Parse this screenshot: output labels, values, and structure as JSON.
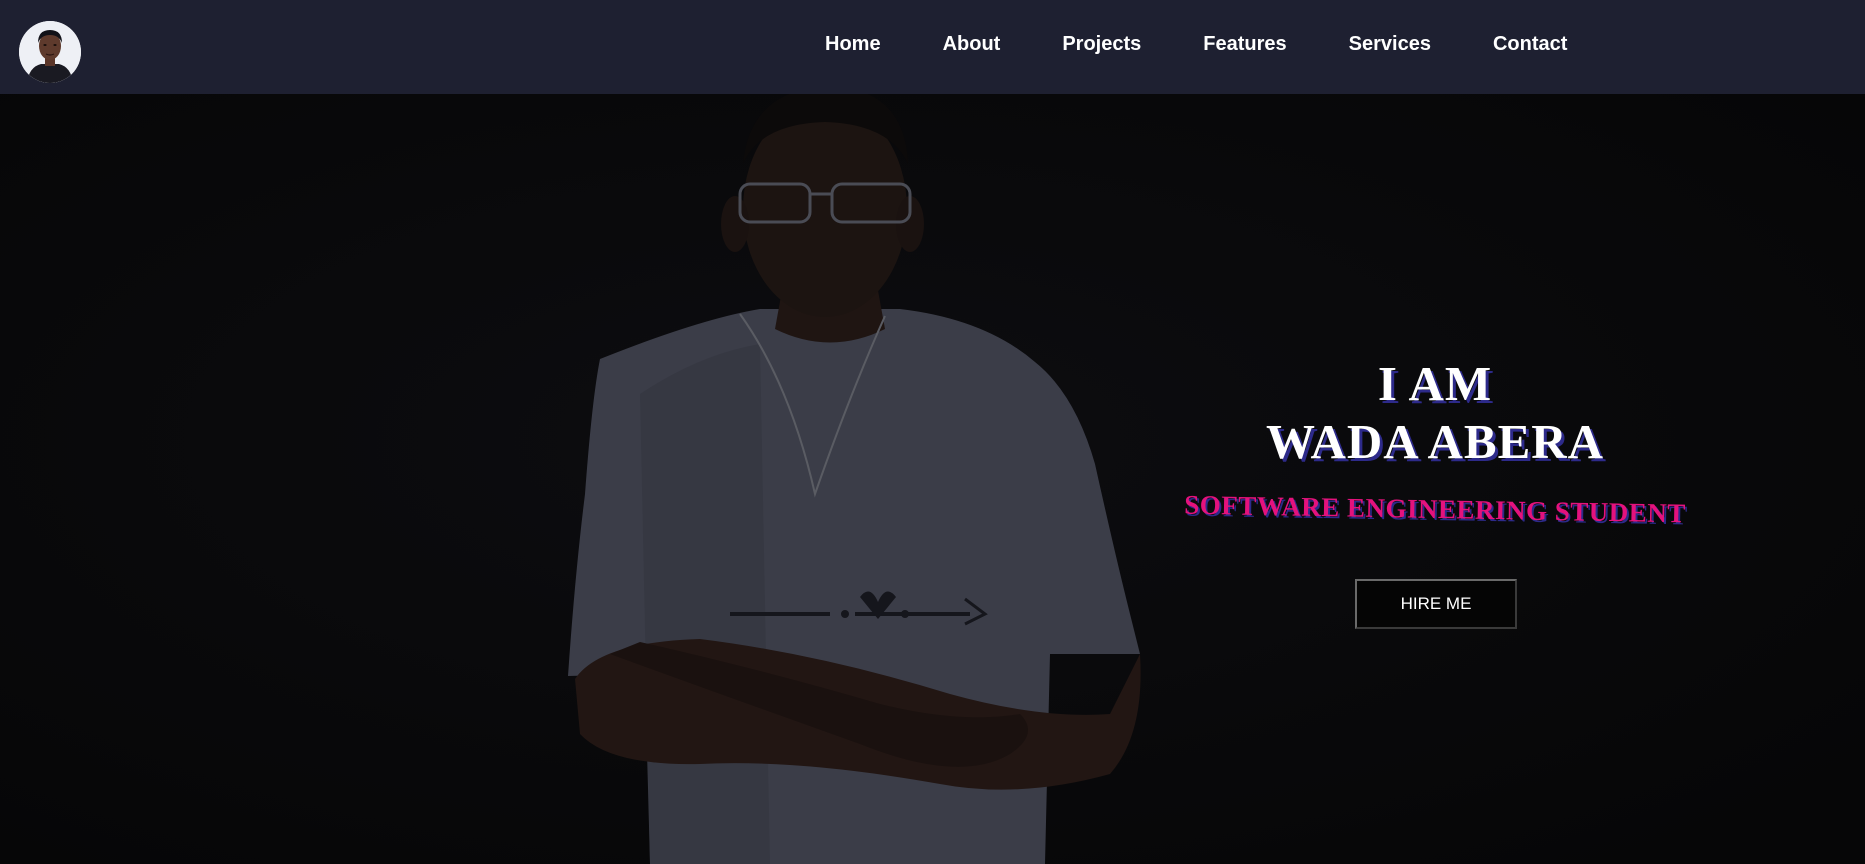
{
  "nav": {
    "items": [
      {
        "label": "Home"
      },
      {
        "label": "About"
      },
      {
        "label": "Projects"
      },
      {
        "label": "Features"
      },
      {
        "label": "Services"
      },
      {
        "label": "Contact"
      }
    ]
  },
  "hero": {
    "line1": "I AM",
    "line2": "WADA ABERA",
    "subtitle": "SOFTWARE ENGINEERING STUDENT",
    "cta_label": "HIRE ME"
  },
  "colors": {
    "navbar_bg": "#1e2031",
    "hero_bg": "#080809",
    "heading_text": "#ffffff",
    "heading_shadow": "#2d2a8a",
    "subtitle_text": "#e4127d"
  }
}
